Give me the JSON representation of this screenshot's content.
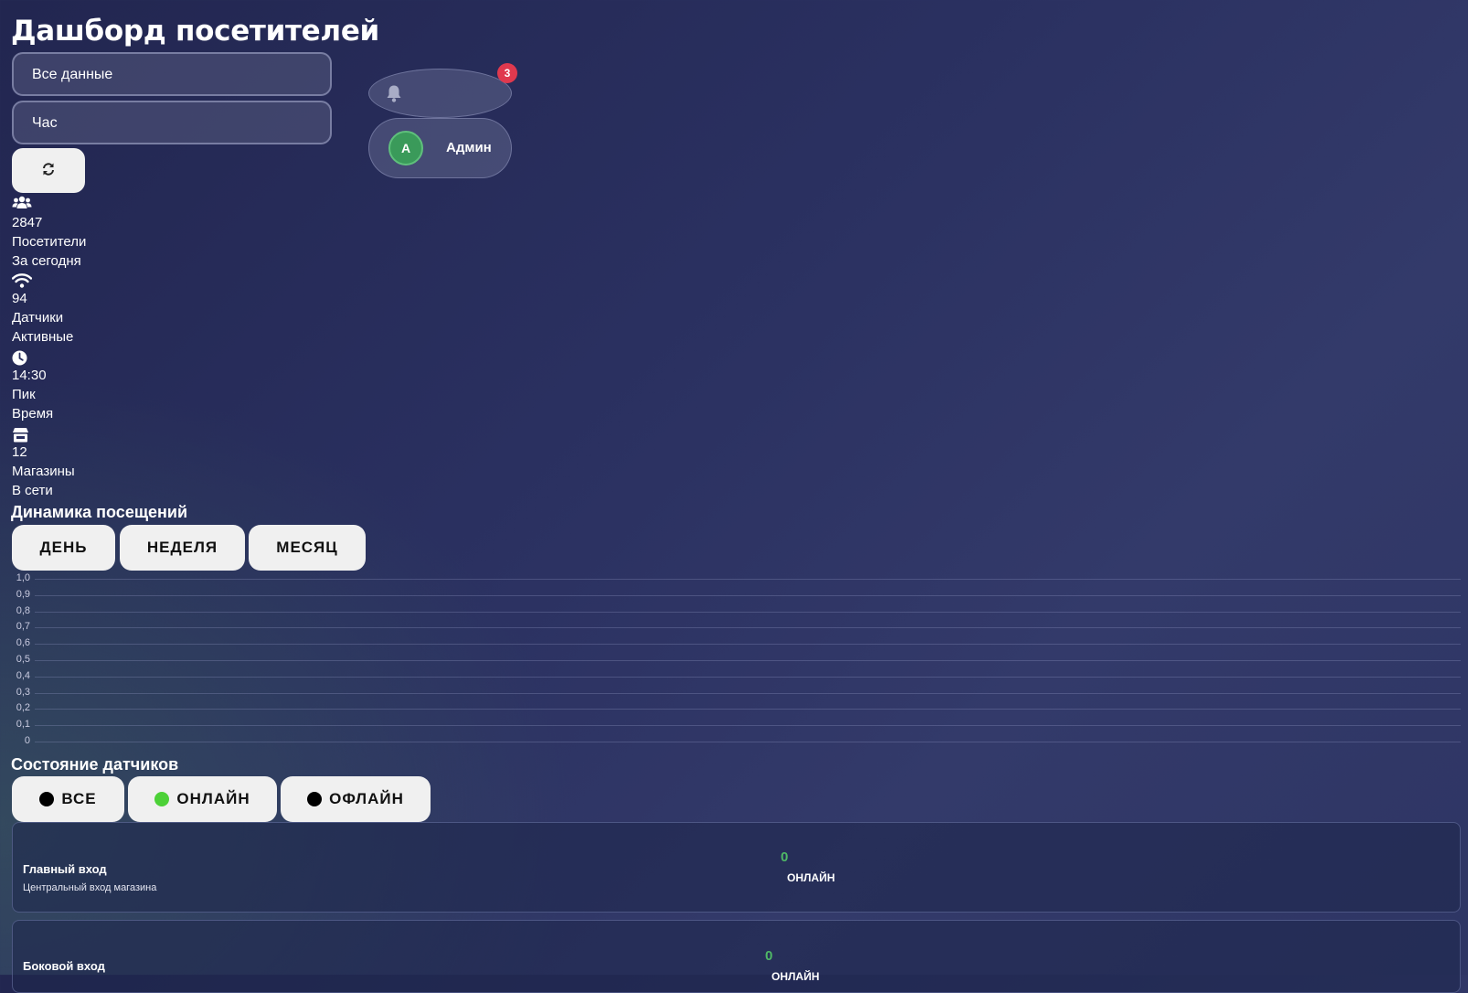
{
  "header": {
    "title": "Дашборд посетителей"
  },
  "filters": {
    "data_select": "Все данные",
    "period_select": "Час"
  },
  "notifications": {
    "count": "3"
  },
  "user": {
    "avatar_letter": "A",
    "name": "Админ"
  },
  "stats": [
    {
      "icon": "users-icon",
      "value": "2847",
      "label": "Посетители",
      "sublabel": "За сегодня"
    },
    {
      "icon": "wifi-icon",
      "value": "94",
      "label": "Датчики",
      "sublabel": "Активные"
    },
    {
      "icon": "clock-icon",
      "value": "14:30",
      "label": "Пик",
      "sublabel": "Время"
    },
    {
      "icon": "store-icon",
      "value": "12",
      "label": "Магазины",
      "sublabel": "В сети"
    }
  ],
  "visits": {
    "title": "Динамика посещений",
    "periods": [
      "ДЕНЬ",
      "НЕДЕЛЯ",
      "МЕСЯЦ"
    ]
  },
  "chart_data": {
    "type": "line",
    "series": [],
    "ylim": [
      0,
      1
    ],
    "yticks": [
      "1,0",
      "0,9",
      "0,8",
      "0,7",
      "0,6",
      "0,5",
      "0,4",
      "0,3",
      "0,2",
      "0,1",
      "0"
    ],
    "grid": true
  },
  "sensors": {
    "title": "Состояние датчиков",
    "filters": [
      {
        "label": "ВСЕ",
        "dot_color": "#000000"
      },
      {
        "label": "ОНЛАЙН",
        "dot_color": "#4cd137"
      },
      {
        "label": "ОФЛАЙН",
        "dot_color": "#000000"
      }
    ],
    "items": [
      {
        "name": "Главный вход",
        "description": "Центральный вход магазина",
        "count": "0",
        "status": "ОНЛАЙН"
      },
      {
        "name": "Боковой вход",
        "description": "",
        "count": "0",
        "status": "ОНЛАЙН"
      }
    ]
  },
  "colors": {
    "accent_green": "#4fb866",
    "badge_red": "#e0394e",
    "button_bg": "#f0f0f0"
  }
}
